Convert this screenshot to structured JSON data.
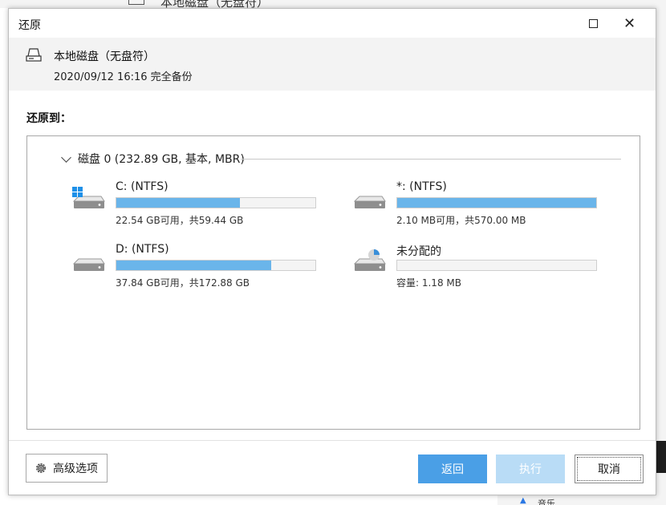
{
  "background": {
    "top_text": "本地磁盘（无盘符）",
    "bottom_text": "音乐"
  },
  "dialog": {
    "title": "还原"
  },
  "header": {
    "title": "本地磁盘（无盘符）",
    "subtitle": "2020/09/12 16:16 完全备份"
  },
  "restore_to": {
    "label": "还原到："
  },
  "disk": {
    "label": "磁盘 0 (232.89 GB, 基本, MBR)",
    "partitions": [
      {
        "name": "C: (NTFS)",
        "info": "22.54 GB可用，共59.44 GB",
        "used_fraction": 0.62,
        "icon": "windows-drive-icon"
      },
      {
        "name": "*: (NTFS)",
        "info": "2.10 MB可用，共570.00 MB",
        "used_fraction": 1.0,
        "icon": "drive-icon"
      },
      {
        "name": "D: (NTFS)",
        "info": "37.84 GB可用，共172.88 GB",
        "used_fraction": 0.78,
        "icon": "drive-icon"
      },
      {
        "name": "未分配的",
        "info": "容量: 1.18 MB",
        "used_fraction": 0.0,
        "icon": "unallocated-drive-icon"
      }
    ]
  },
  "footer": {
    "advanced_label": "高级选项",
    "back_label": "返回",
    "execute_label": "执行",
    "cancel_label": "取消"
  },
  "colors": {
    "bar_fill": "#6ab5ea",
    "primary_button": "#4a9fe6",
    "disabled_button": "#b9dcf6",
    "windows_logo": "#1e90e8"
  }
}
